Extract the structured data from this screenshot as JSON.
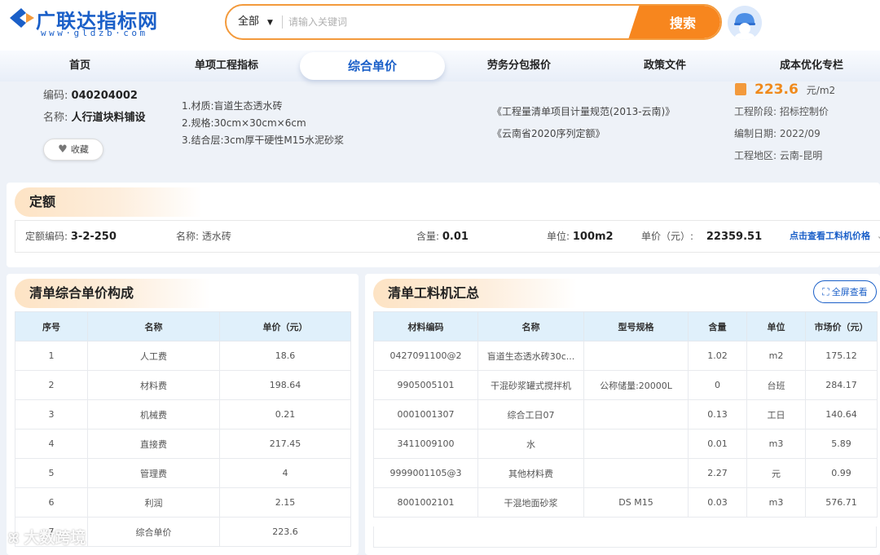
{
  "brand": {
    "name": "广联达指标网",
    "url": "www·gldzb·com"
  },
  "search": {
    "scope": "全部",
    "placeholder": "请输入关键词",
    "button": "搜索"
  },
  "nav": {
    "items": [
      "首页",
      "单项工程指标",
      "综合单价",
      "劳务分包报价",
      "政策文件",
      "成本优化专栏"
    ],
    "active_index": 2
  },
  "item": {
    "code_label": "编码:",
    "code": "040204002",
    "name_label": "名称:",
    "name": "人行道块料铺设",
    "favorite": "收藏",
    "features": [
      "1.材质:盲道生态透水砖",
      "2.规格:30cm×30cm×6cm",
      "3.结合层:3cm厚干硬性M15水泥砂浆"
    ],
    "references": [
      "《工程量清单项目计量规范(2013-云南)》",
      "《云南省2020序列定额》"
    ],
    "price": "223.6",
    "price_unit": "元/m2",
    "meta": [
      "工程阶段:  招标控制价",
      "编制日期:  2022/09",
      "工程地区:  云南-昆明"
    ]
  },
  "quota": {
    "title": "定额",
    "code_label": "定额编码:",
    "code": "3-2-250",
    "name_label": "名称:",
    "name": "透水砖",
    "amount_label": "含量:",
    "amount": "0.01",
    "unit_label": "单位:",
    "unit": "100m2",
    "price_label": "单价（元）:",
    "price": "22359.51",
    "link": "点击查看工料机价格"
  },
  "composition": {
    "title": "清单综合单价构成",
    "headers": [
      "序号",
      "名称",
      "单价（元）"
    ],
    "rows": [
      [
        "1",
        "人工费",
        "18.6"
      ],
      [
        "2",
        "材料费",
        "198.64"
      ],
      [
        "3",
        "机械费",
        "0.21"
      ],
      [
        "4",
        "直接费",
        "217.45"
      ],
      [
        "5",
        "管理费",
        "4"
      ],
      [
        "6",
        "利润",
        "2.15"
      ],
      [
        "7",
        "综合单价",
        "223.6"
      ]
    ]
  },
  "materials": {
    "title": "清单工料机汇总",
    "fullscreen": "全屏查看",
    "headers": [
      "材料编码",
      "名称",
      "型号规格",
      "含量",
      "单位",
      "市场价（元）"
    ],
    "rows": [
      [
        "0427091100@2",
        "盲道生态透水砖30c...",
        "",
        "1.02",
        "m2",
        "175.12"
      ],
      [
        "9905005101",
        "干混砂浆罐式搅拌机",
        "公称储量:20000L",
        "0",
        "台班",
        "284.17"
      ],
      [
        "0001001307",
        "综合工日07",
        "",
        "0.13",
        "工日",
        "140.64"
      ],
      [
        "3411009100",
        "水",
        "",
        "0.01",
        "m3",
        "5.89"
      ],
      [
        "9999001105@3",
        "其他材料费",
        "",
        "2.27",
        "元",
        "0.99"
      ],
      [
        "8001002101",
        "干混地面砂浆",
        "DS M15",
        "0.03",
        "m3",
        "576.71"
      ]
    ]
  },
  "watermark": "大数跨境",
  "colors": {
    "brand_blue": "#1a5fc8",
    "accent_orange": "#f7861e",
    "table_header": "#e0f0fb"
  }
}
